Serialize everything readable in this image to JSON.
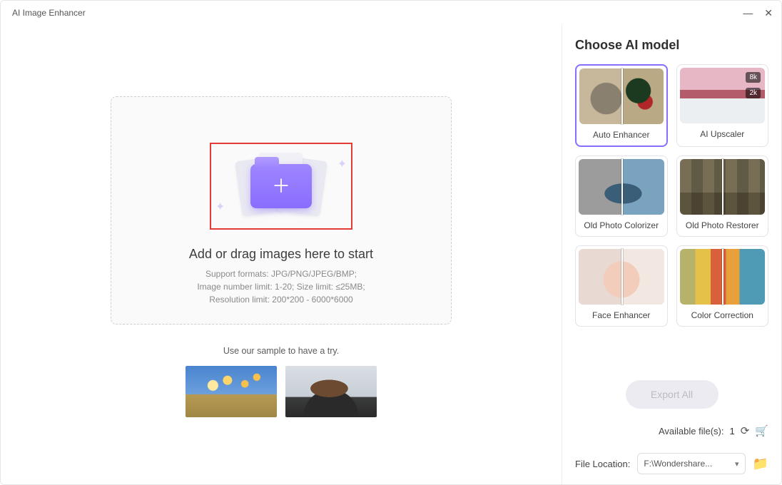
{
  "window": {
    "title": "AI Image Enhancer"
  },
  "drop": {
    "headline": "Add or drag images here to start",
    "line1": "Support formats: JPG/PNG/JPEG/BMP;",
    "line2": "Image number limit: 1-20; Size limit: ≤25MB;",
    "line3": "Resolution limit: 200*200 - 6000*6000"
  },
  "samples": {
    "label": "Use our sample to have a try."
  },
  "sidebar": {
    "heading": "Choose AI model",
    "models": [
      {
        "label": "Auto Enhancer",
        "selected": true
      },
      {
        "label": "AI Upscaler",
        "selected": false,
        "badge_low": "2k",
        "badge_high": "8k"
      },
      {
        "label": "Old Photo Colorizer",
        "selected": false
      },
      {
        "label": "Old Photo Restorer",
        "selected": false
      },
      {
        "label": "Face Enhancer",
        "selected": false
      },
      {
        "label": "Color Correction",
        "selected": false
      }
    ],
    "export_label": "Export All",
    "available_label": "Available file(s):",
    "available_count": "1",
    "location_label": "File Location:",
    "location_value": "F:\\Wondershare..."
  }
}
